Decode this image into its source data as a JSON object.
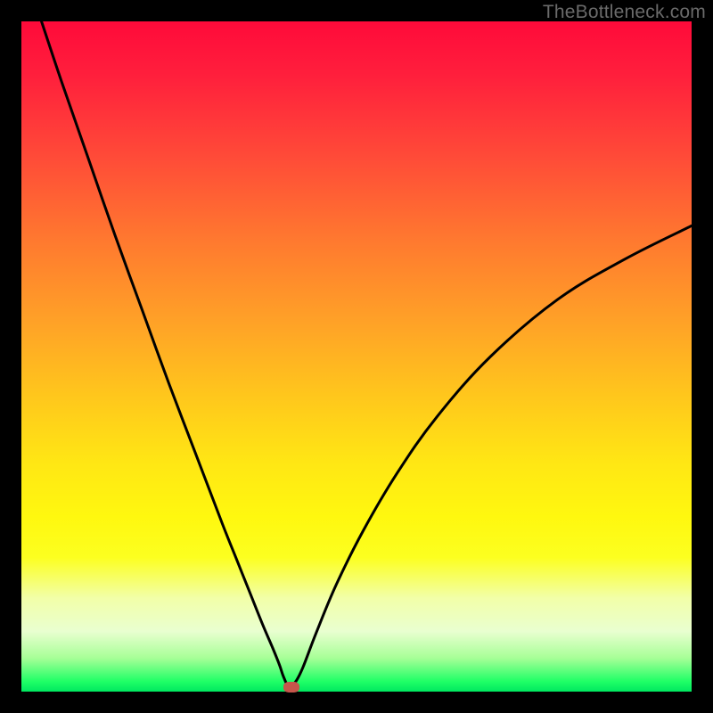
{
  "watermark": {
    "text": "TheBottleneck.com"
  },
  "chart_data": {
    "type": "line",
    "title": "",
    "xlabel": "",
    "ylabel": "",
    "xlim": [
      0,
      100
    ],
    "ylim": [
      0,
      100
    ],
    "grid": false,
    "legend": false,
    "series": [
      {
        "name": "curve",
        "x": [
          3,
          6,
          10,
          14,
          18,
          22,
          26,
          30,
          32,
          34,
          36,
          37.5,
          38.5,
          39,
          39.5,
          39.8,
          40,
          41,
          42,
          44,
          47,
          51,
          56,
          62,
          70,
          80,
          90,
          100
        ],
        "y": [
          100,
          91,
          79.5,
          68,
          57,
          46,
          35.5,
          25,
          20,
          15,
          10,
          6.5,
          4,
          2.5,
          1.3,
          0.6,
          0.4,
          1.6,
          3.6,
          8.8,
          16,
          24,
          32.5,
          41,
          50,
          58.5,
          64.5,
          69.5
        ]
      }
    ],
    "marker": {
      "x": 40.3,
      "y": 0.6,
      "color": "#c6564b"
    },
    "background_gradient": {
      "top": "#ff0a3a",
      "bottom": "#00e860"
    }
  }
}
